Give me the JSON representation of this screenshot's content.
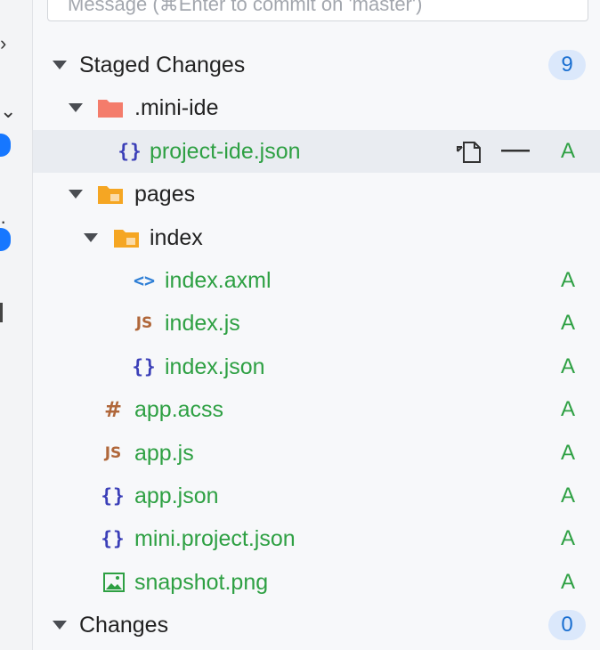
{
  "commit": {
    "placeholder": "Message (⌘Enter to commit on 'master')"
  },
  "staged": {
    "title": "Staged Changes",
    "count": "9",
    "tree": {
      "mini_ide_folder": ".mini-ide",
      "project_ide_json": "project-ide.json",
      "pages_folder": "pages",
      "index_folder": "index",
      "index_axml": "index.axml",
      "index_js": "index.js",
      "index_json": "index.json",
      "app_acss": "app.acss",
      "app_js": "app.js",
      "app_json": "app.json",
      "mini_project_json": "mini.project.json",
      "snapshot_png": "snapshot.png"
    },
    "status_added": "A"
  },
  "changes": {
    "title": "Changes",
    "count": "0"
  },
  "colors": {
    "added": "#2ea043",
    "badge_bg": "#dbe8fb",
    "badge_text": "#1a6fd1",
    "folder_red": "#f47c6b",
    "folder_orange": "#f5a623"
  },
  "icons": {
    "json": "{}",
    "js": "JS",
    "css": "#",
    "xml": "<>"
  }
}
